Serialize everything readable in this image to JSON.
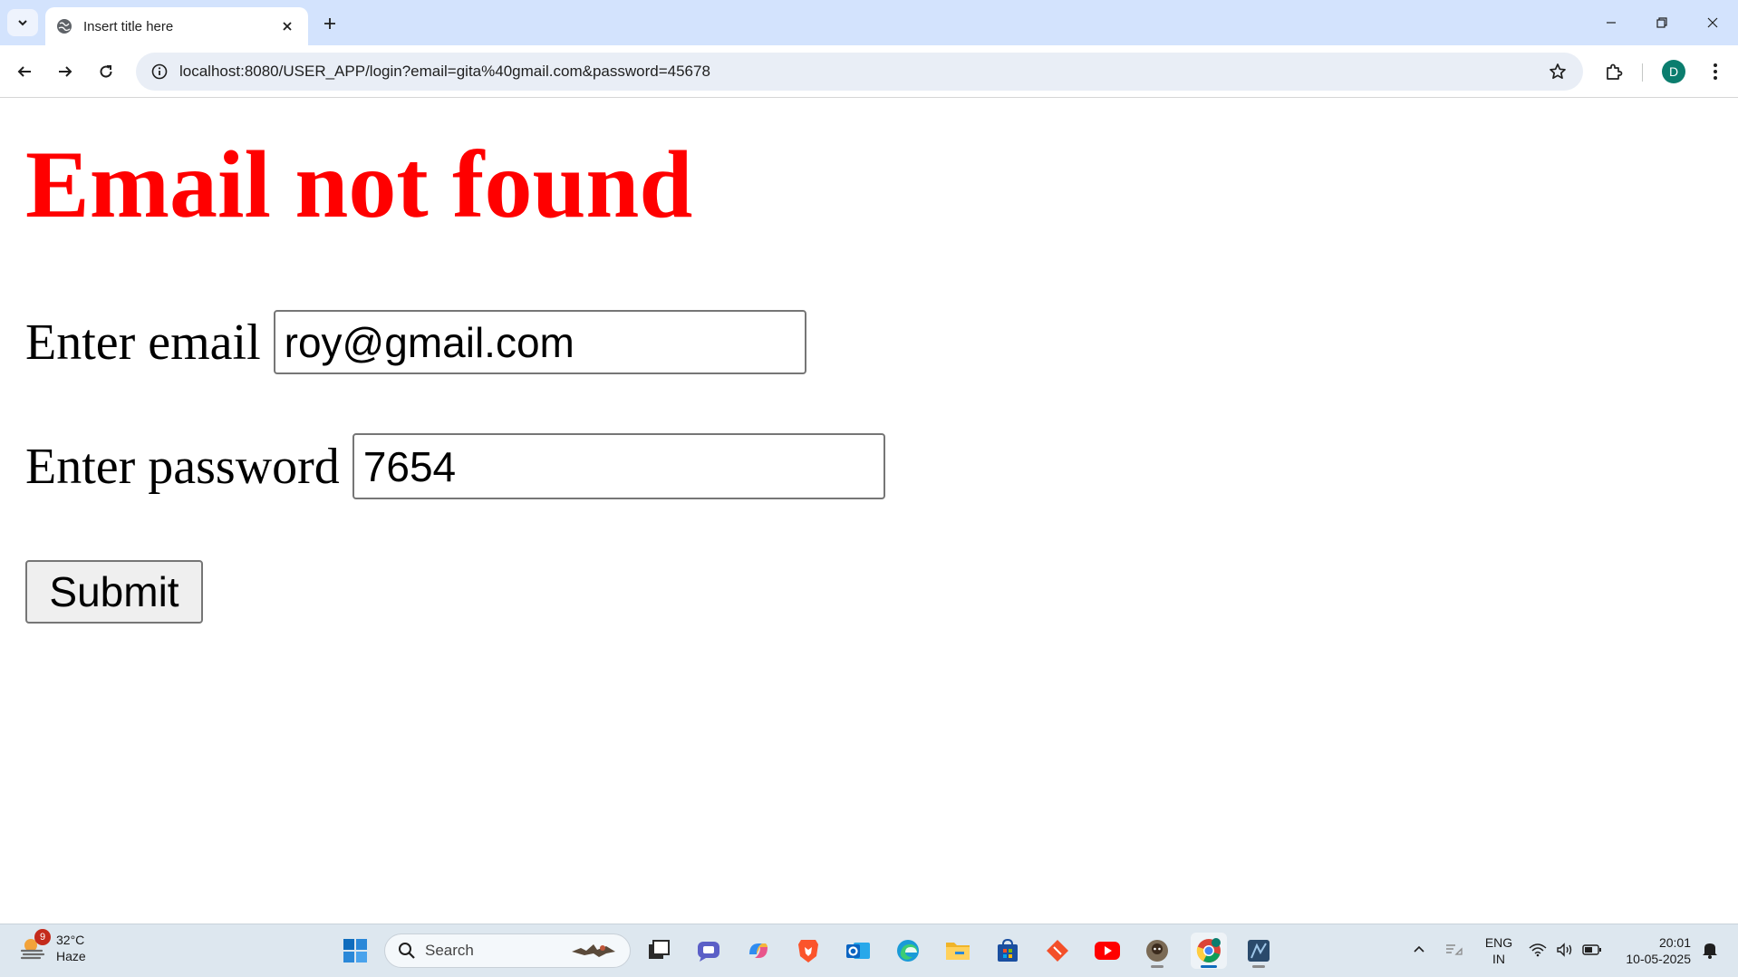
{
  "browser": {
    "tab_title": "Insert title here",
    "url": "localhost:8080/USER_APP/login?email=gita%40gmail.com&password=45678",
    "profile_initial": "D"
  },
  "page": {
    "heading": "Email not found",
    "email_label": "Enter email",
    "email_value": "roy@gmail.com",
    "password_label": "Enter password",
    "password_value": "7654",
    "submit_label": "Submit"
  },
  "taskbar": {
    "weather_temp": "32°C",
    "weather_desc": "Haze",
    "weather_badge": "9",
    "search_placeholder": "Search",
    "lang_line1": "ENG",
    "lang_line2": "IN",
    "time": "20:01",
    "date": "10-05-2025",
    "apps": [
      "start-icon",
      "task-view-icon",
      "teams-chat-icon",
      "copilot-icon",
      "brave-icon",
      "outlook-icon",
      "edge-icon",
      "file-explorer-icon",
      "microsoft-store-icon",
      "git-icon",
      "youtube-icon",
      "app-avatar-icon",
      "chrome-icon",
      "mysql-workbench-icon"
    ]
  },
  "colors": {
    "heading": "#ff0000",
    "tabstrip": "#d3e3fd",
    "omnibox": "#e9eef6",
    "taskbar": "#dde7ef"
  }
}
